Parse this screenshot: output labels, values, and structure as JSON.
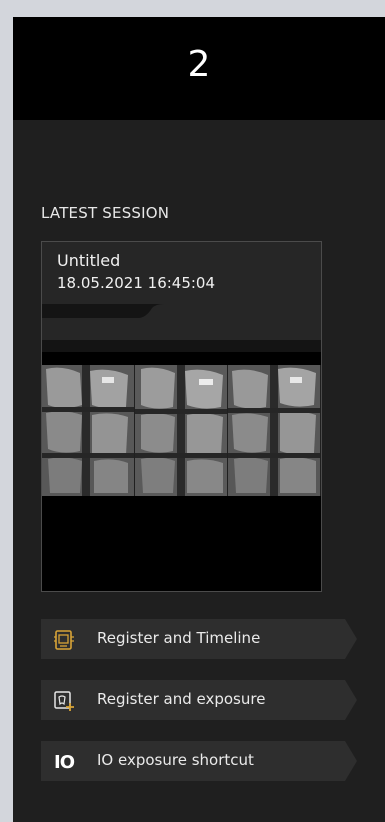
{
  "header": {
    "step_number": "2"
  },
  "latest_session": {
    "section_title": "LATEST SESSION",
    "name": "Untitled",
    "datetime": "18.05.2021 16:45:04"
  },
  "actions": [
    {
      "label": "Register and Timeline",
      "icon": "register-timeline-icon"
    },
    {
      "label": "Register and exposure",
      "icon": "register-exposure-icon"
    },
    {
      "label": "IO exposure shortcut",
      "icon": "io-exposure-icon",
      "icon_text": "IO"
    }
  ],
  "colors": {
    "panel_bg": "#1f1f1f",
    "header_bg": "#000000",
    "button_bg": "#2e2e2e",
    "accent_orange": "#d8a437"
  }
}
